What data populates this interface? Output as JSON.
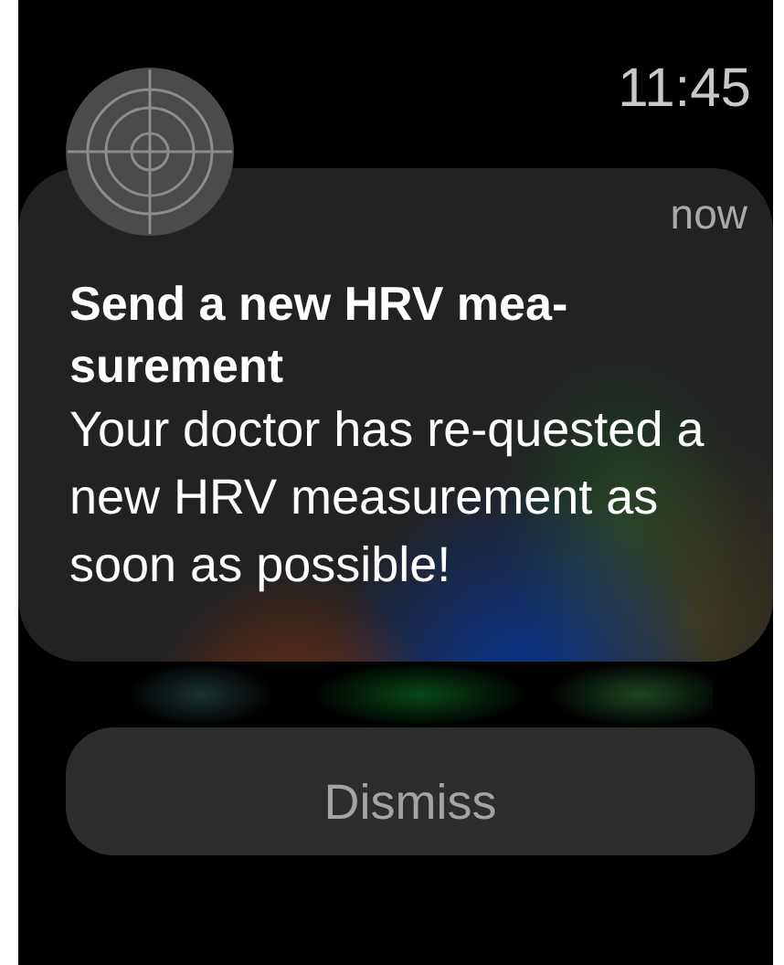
{
  "status_bar": {
    "time": "11:45"
  },
  "notification": {
    "timestamp": "now",
    "title": "Send a new HRV mea-surement",
    "body": "Your doctor has re-quested a new HRV measurement as soon as possible!"
  },
  "buttons": [
    "Dismiss"
  ]
}
